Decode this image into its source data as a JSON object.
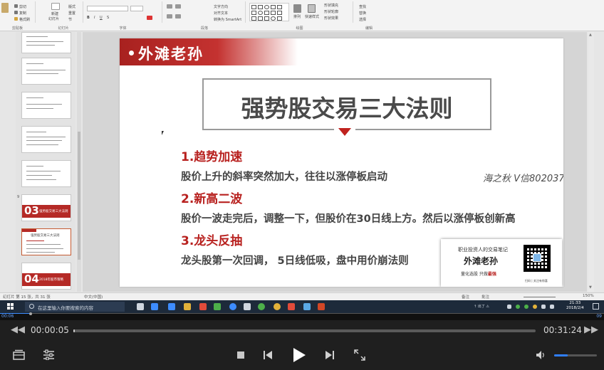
{
  "ribbon": {
    "groups": [
      {
        "label": "剪贴板"
      },
      {
        "label": "幻灯片"
      },
      {
        "label": "字体"
      },
      {
        "label": "段落"
      },
      {
        "label": "绘图"
      },
      {
        "label": "编辑"
      }
    ],
    "buttons": {
      "cut": "剪切",
      "copy": "复制",
      "format_painter": "格式刷",
      "new_slide": "新建",
      "new_slide2": "幻灯片",
      "layout": "版式",
      "reset": "重置",
      "section": "节",
      "text_direction": "文字方向",
      "align_text": "对齐文本",
      "smartart": "转换为 SmartArt",
      "arrange": "排列",
      "quick_styles": "快速样式",
      "shape_fill": "形状填充",
      "shape_outline": "形状轮廓",
      "shape_effects": "形状效果",
      "find": "查找",
      "replace": "替换",
      "select": "选择"
    }
  },
  "thumbnails": [
    {
      "num": "",
      "type": "text"
    },
    {
      "num": "",
      "type": "text"
    },
    {
      "num": "",
      "type": "text"
    },
    {
      "num": "",
      "type": "text"
    },
    {
      "num": "",
      "type": "text"
    },
    {
      "num": "9",
      "type": "red",
      "big": "03",
      "title": "强势股交易三大法则"
    },
    {
      "num": "",
      "type": "selected",
      "title": "强势股交易三大法则"
    },
    {
      "num": "",
      "type": "red",
      "big": "04",
      "title": "2018年股市策略"
    }
  ],
  "slide": {
    "banner": "外滩老孙",
    "title": "强势股交易三大法则",
    "rules": [
      {
        "heading": "1.趋势加速",
        "text": "股价上升的斜率突然加大，往往以涨停板启动"
      },
      {
        "heading": "2.新高二波",
        "text": "股价一波走完后，调整一下，但股价在30日线上方。然后以涨停板创新高"
      },
      {
        "heading": "3.龙头反抽",
        "text": "龙头股第一次回调，   5日线低吸，盘中用价崩法则"
      }
    ],
    "watermark": "海之秋 V信80203733",
    "card": {
      "top": "职业投资人的交易笔记",
      "name": "外滩老孙",
      "bottom_prefix": "量化选股 只做",
      "bottom_highlight": "最强",
      "qr_caption": "扫码 | 关注有惊喜"
    }
  },
  "statusbar": {
    "slide_info": "幻灯片 第 15 张，共 31 张",
    "language": "中文(中国)",
    "notes": "备注",
    "comments": "批注",
    "zoom": "150%"
  },
  "taskbar": {
    "search_placeholder": "在这里输入你要搜索的内容",
    "tray_text": "↑ 出了 ⚠ ",
    "time": "21:33",
    "date": "2018/2/4"
  },
  "player": {
    "mini_current": "00:06",
    "mini_total": "09",
    "current_time": "00:00:05",
    "total_time": "00:31:24",
    "progress": 0.0027,
    "volume": 0.32,
    "icons": {
      "rewind": "rewind-icon",
      "forward": "fast-forward-icon",
      "playlist": "playlist-icon",
      "settings": "equalizer-icon",
      "stop": "stop-icon",
      "prev": "previous-icon",
      "play": "play-icon",
      "next": "next-icon",
      "fullscreen": "fullscreen-icon",
      "volume": "volume-icon"
    }
  },
  "colors": {
    "slide_red": "#b8211f",
    "player_bg": "#1f1f1f",
    "volume_blue": "#2f7fff"
  }
}
